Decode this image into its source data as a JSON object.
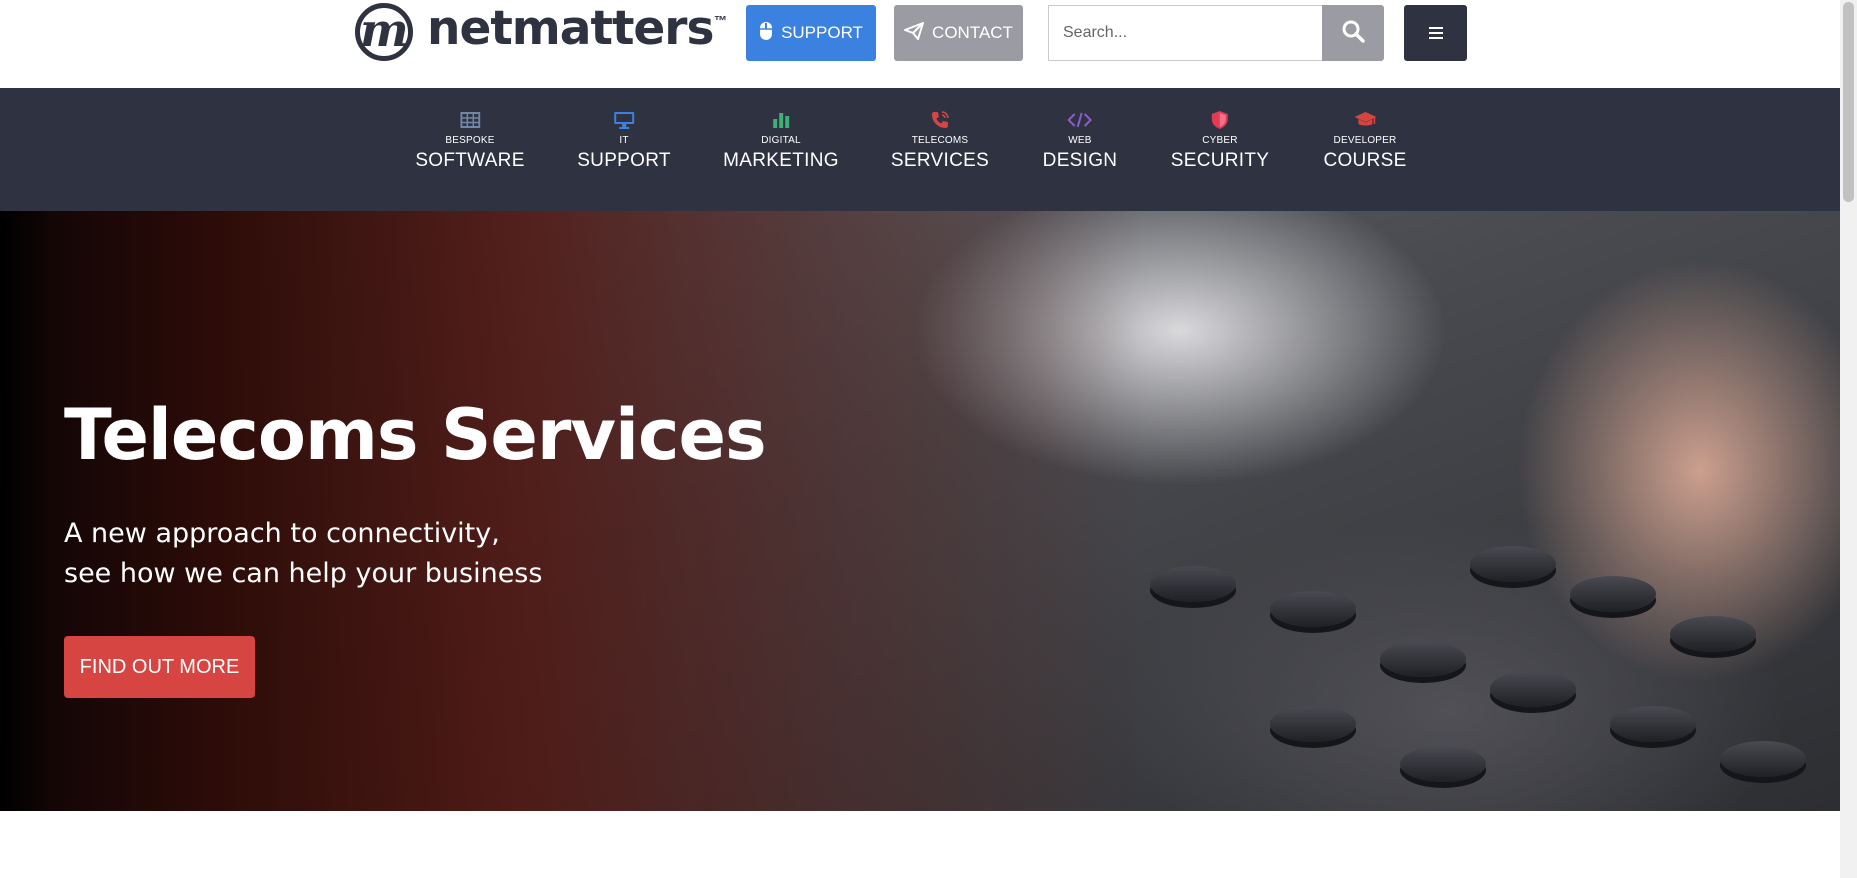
{
  "header": {
    "logo_text": "netmatters",
    "logo_mark": "m",
    "logo_tm": "™",
    "support_label": "SUPPORT",
    "contact_label": "CONTACT",
    "search_placeholder": "Search...",
    "search_value": "",
    "menu_icon": "hamburger-icon"
  },
  "nav": {
    "items": [
      {
        "small": "BESPOKE",
        "big": "SOFTWARE",
        "icon": "table-grid-icon",
        "color": "#7386a8"
      },
      {
        "small": "IT",
        "big": "SUPPORT",
        "icon": "desktop-icon",
        "color": "#3b82e0"
      },
      {
        "small": "DIGITAL",
        "big": "MARKETING",
        "icon": "bar-chart-icon",
        "color": "#3bb273"
      },
      {
        "small": "TELECOMS",
        "big": "SERVICES",
        "icon": "phone-icon",
        "color": "#d64541"
      },
      {
        "small": "WEB",
        "big": "DESIGN",
        "icon": "code-icon",
        "color": "#8e5cc7"
      },
      {
        "small": "CYBER",
        "big": "SECURITY",
        "icon": "shield-icon",
        "color": "#e33a55"
      },
      {
        "small": "DEVELOPER",
        "big": "COURSE",
        "icon": "graduation-cap-icon",
        "color": "#d64541"
      }
    ]
  },
  "hero": {
    "title": "Telecoms Services",
    "subtitle_line1": "A new approach to connectivity,",
    "subtitle_line2": "see how we can help your business",
    "cta_label": "FIND OUT MORE"
  },
  "colors": {
    "brand_dark": "#2f3241",
    "support_blue": "#3b82e0",
    "contact_grey": "#9b9ba3",
    "cta_red": "#d64541"
  }
}
